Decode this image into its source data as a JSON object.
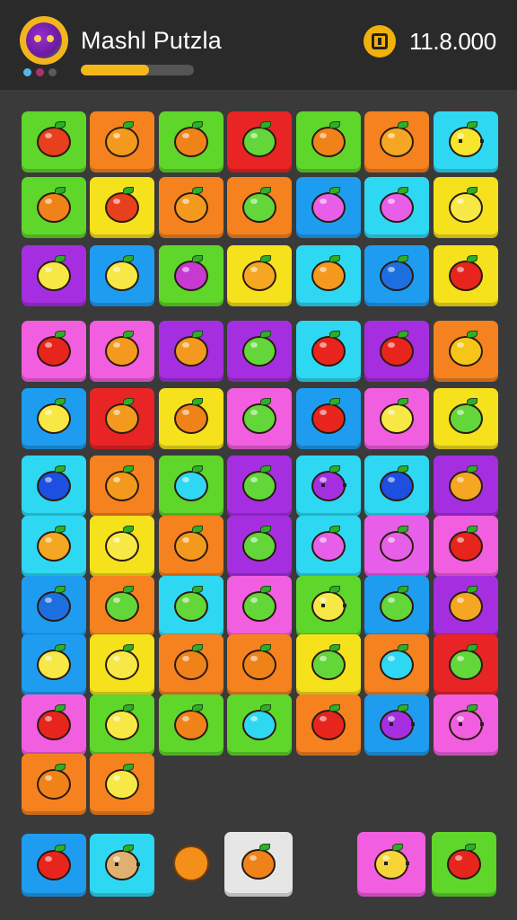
{
  "header": {
    "title": "Mashl Putzla",
    "coins": "11.8.000",
    "level_progress": 0.6,
    "avatar_icon": "monster-avatar-icon",
    "status_dots": [
      "#4fb9e8",
      "#b0306a",
      "#5a5a5a"
    ]
  },
  "board": {
    "rows": [
      [
        {
          "bg": "#5fd62a",
          "fruit": "#e8401c",
          "icon": "sun-fruit-icon"
        },
        {
          "bg": "#f5821f",
          "fruit": "#f39a1e",
          "icon": "orange-icon"
        },
        {
          "bg": "#5fd62a",
          "fruit": "#f0821a",
          "icon": "orange-icon"
        },
        {
          "bg": "#e82424",
          "fruit": "#63d63a",
          "icon": "apple-icon"
        },
        {
          "bg": "#5fd62a",
          "fruit": "#f0821a",
          "icon": "orange-icon"
        },
        {
          "bg": "#f5821f",
          "fruit": "#f5a623",
          "icon": "orange-icon"
        },
        {
          "bg": "#2fd8f2",
          "fruit": "#f6e52c",
          "icon": "face-fruit-icon"
        }
      ],
      [
        {
          "bg": "#5fd62a",
          "fruit": "#f0821a",
          "icon": "carrot-icon"
        },
        {
          "bg": "#f5e11c",
          "fruit": "#e8401c",
          "icon": "tomato-icon"
        },
        {
          "bg": "#f5821f",
          "fruit": "#f39a1e",
          "icon": "orange-icon"
        },
        {
          "bg": "#f5821f",
          "fruit": "#63d63a",
          "icon": "apple-icon"
        },
        {
          "bg": "#1e9cf0",
          "fruit": "#e75fe8",
          "icon": "plum-icon"
        },
        {
          "bg": "#2fd8f2",
          "fruit": "#e75fe8",
          "icon": "plum-icon"
        },
        {
          "bg": "#f5e11c",
          "fruit": "#f7e845",
          "icon": "lemon-icon"
        }
      ],
      [
        {
          "bg": "#a52fe0",
          "fruit": "#f7e845",
          "icon": "lemon-icon"
        },
        {
          "bg": "#1e9cf0",
          "fruit": "#f7e845",
          "icon": "lemon-icon"
        },
        {
          "bg": "#5fd62a",
          "fruit": "#c63ad2",
          "icon": "plum-icon"
        },
        {
          "bg": "#f5e11c",
          "fruit": "#f5a623",
          "icon": "orange-icon"
        },
        {
          "bg": "#2fd8f2",
          "fruit": "#f39a1e",
          "icon": "orange-icon"
        },
        {
          "bg": "#1e9cf0",
          "fruit": "#1d6fe0",
          "icon": "plum-icon"
        },
        {
          "bg": "#f5e11c",
          "fruit": "#e8251c",
          "icon": "strawberry-icon"
        }
      ],
      [
        {
          "bg": "#f25ee0",
          "fruit": "#e8251c",
          "icon": "apple-icon"
        },
        {
          "bg": "#f25ee0",
          "fruit": "#f39a1e",
          "icon": "orange-icon"
        },
        {
          "bg": "#a52fe0",
          "fruit": "#f39a1e",
          "icon": "orange-icon"
        },
        {
          "bg": "#a52fe0",
          "fruit": "#63d63a",
          "icon": "leaf-fruit-icon"
        },
        {
          "bg": "#2fd8f2",
          "fruit": "#e8251c",
          "icon": "pepper-icon"
        },
        {
          "bg": "#a52fe0",
          "fruit": "#e8251c",
          "icon": "pepper-icon"
        },
        {
          "bg": "#f5821f",
          "fruit": "#f5c518",
          "icon": "mango-icon"
        }
      ],
      [
        {
          "bg": "#1e9cf0",
          "fruit": "#f7e845",
          "icon": "lemon-icon"
        },
        {
          "bg": "#e82424",
          "fruit": "#f39a1e",
          "icon": "orange-icon"
        },
        {
          "bg": "#f5e11c",
          "fruit": "#f0821a",
          "icon": "carrot-icon"
        },
        {
          "bg": "#f25ee0",
          "fruit": "#63d63a",
          "icon": "apple-icon"
        },
        {
          "bg": "#1e9cf0",
          "fruit": "#e8251c",
          "icon": "pepper-icon"
        },
        {
          "bg": "#f25ee0",
          "fruit": "#f7e845",
          "icon": "lemon-icon"
        },
        {
          "bg": "#f5e11c",
          "fruit": "#63d63a",
          "icon": "leaf-fruit-icon"
        }
      ],
      [
        {
          "bg": "#2fd8f2",
          "fruit": "#1d4fe0",
          "icon": "blueberry-icon"
        },
        {
          "bg": "#f5821f",
          "fruit": "#f39a1e",
          "icon": "orange-icon"
        },
        {
          "bg": "#5fd62a",
          "fruit": "#2fd8f2",
          "icon": "berry-icon"
        },
        {
          "bg": "#a52fe0",
          "fruit": "#63d63a",
          "icon": "apple-icon"
        },
        {
          "bg": "#2fd8f2",
          "fruit": "#a52fe0",
          "icon": "grape-face-icon"
        },
        {
          "bg": "#2fd8f2",
          "fruit": "#1d4fe0",
          "icon": "blueberry-icon"
        },
        {
          "bg": "#a52fe0",
          "fruit": "#f5a623",
          "icon": "mango-icon"
        }
      ],
      [
        {
          "bg": "#2fd8f2",
          "fruit": "#f5a623",
          "icon": "orange-icon"
        },
        {
          "bg": "#f5e11c",
          "fruit": "#f7e845",
          "icon": "lemon-icon"
        },
        {
          "bg": "#f5821f",
          "fruit": "#f39a1e",
          "icon": "orange-icon"
        },
        {
          "bg": "#a52fe0",
          "fruit": "#63d63a",
          "icon": "apple-icon"
        },
        {
          "bg": "#2fd8f2",
          "fruit": "#e75fe8",
          "icon": "plum-icon"
        },
        {
          "bg": "#e75fe8",
          "fruit": "#e75fe8",
          "icon": "plum-icon"
        },
        {
          "bg": "#f25ee0",
          "fruit": "#e8251c",
          "icon": "apple-icon"
        }
      ],
      [
        {
          "bg": "#1e9cf0",
          "fruit": "#1d6fe0",
          "icon": "blueberry-icon"
        },
        {
          "bg": "#f5821f",
          "fruit": "#63d63a",
          "icon": "apple-icon"
        },
        {
          "bg": "#2fd8f2",
          "fruit": "#63d63a",
          "icon": "apple-icon"
        },
        {
          "bg": "#f25ee0",
          "fruit": "#63d63a",
          "icon": "apple-icon"
        },
        {
          "bg": "#5fd62a",
          "fruit": "#f7e845",
          "icon": "face-fruit-icon"
        },
        {
          "bg": "#1e9cf0",
          "fruit": "#63d63a",
          "icon": "apple-icon"
        },
        {
          "bg": "#a52fe0",
          "fruit": "#f5a623",
          "icon": "mango-icon"
        }
      ],
      [
        {
          "bg": "#1e9cf0",
          "fruit": "#f7e845",
          "icon": "banana-icon"
        },
        {
          "bg": "#f5e11c",
          "fruit": "#f7e845",
          "icon": "lemon-icon"
        },
        {
          "bg": "#f5821f",
          "fruit": "#f0821a",
          "icon": "heart-fruit-icon"
        },
        {
          "bg": "#f5821f",
          "fruit": "#f0821a",
          "icon": "heart-fruit-icon"
        },
        {
          "bg": "#f5e11c",
          "fruit": "#63d63a",
          "icon": "apple-icon"
        },
        {
          "bg": "#f5821f",
          "fruit": "#2fd8f2",
          "icon": "berry-icon"
        },
        {
          "bg": "#e82424",
          "fruit": "#63d63a",
          "icon": "apple-icon"
        }
      ],
      [
        {
          "bg": "#f25ee0",
          "fruit": "#e8251c",
          "icon": "apple-icon"
        },
        {
          "bg": "#5fd62a",
          "fruit": "#f7e845",
          "icon": "lemon-icon"
        },
        {
          "bg": "#5fd62a",
          "fruit": "#f0821a",
          "icon": "orange-icon"
        },
        {
          "bg": "#5fd62a",
          "fruit": "#2fd8f2",
          "icon": "berry-icon"
        },
        {
          "bg": "#f5821f",
          "fruit": "#e8251c",
          "icon": "pepper-icon"
        },
        {
          "bg": "#1e9cf0",
          "fruit": "#a52fe0",
          "icon": "grape-face-icon"
        },
        {
          "bg": "#f25ee0",
          "fruit": "#f25ee0",
          "icon": "face-fruit-icon"
        }
      ],
      [
        {
          "bg": "#f5821f",
          "fruit": "#f0821a",
          "icon": "carrot-icon"
        },
        {
          "bg": "#f5821f",
          "fruit": "#f7e845",
          "icon": "star-fruit-icon"
        }
      ]
    ]
  },
  "tray": {
    "items": [
      {
        "bg": "#1e9cf0",
        "fruit": "#e8251c",
        "icon": "apple-icon"
      },
      {
        "bg": "#2fd8f2",
        "fruit": "#e0b070",
        "icon": "bear-icon"
      },
      {
        "bg": "#e6e6e6",
        "fruit": "#f0821a",
        "icon": "carrot-icon"
      },
      {
        "bg": "#f25ee0",
        "fruit": "#f7d43a",
        "icon": "cat-icon"
      },
      {
        "bg": "#5fd62a",
        "fruit": "#e8251c",
        "icon": "apple-icon"
      }
    ]
  }
}
